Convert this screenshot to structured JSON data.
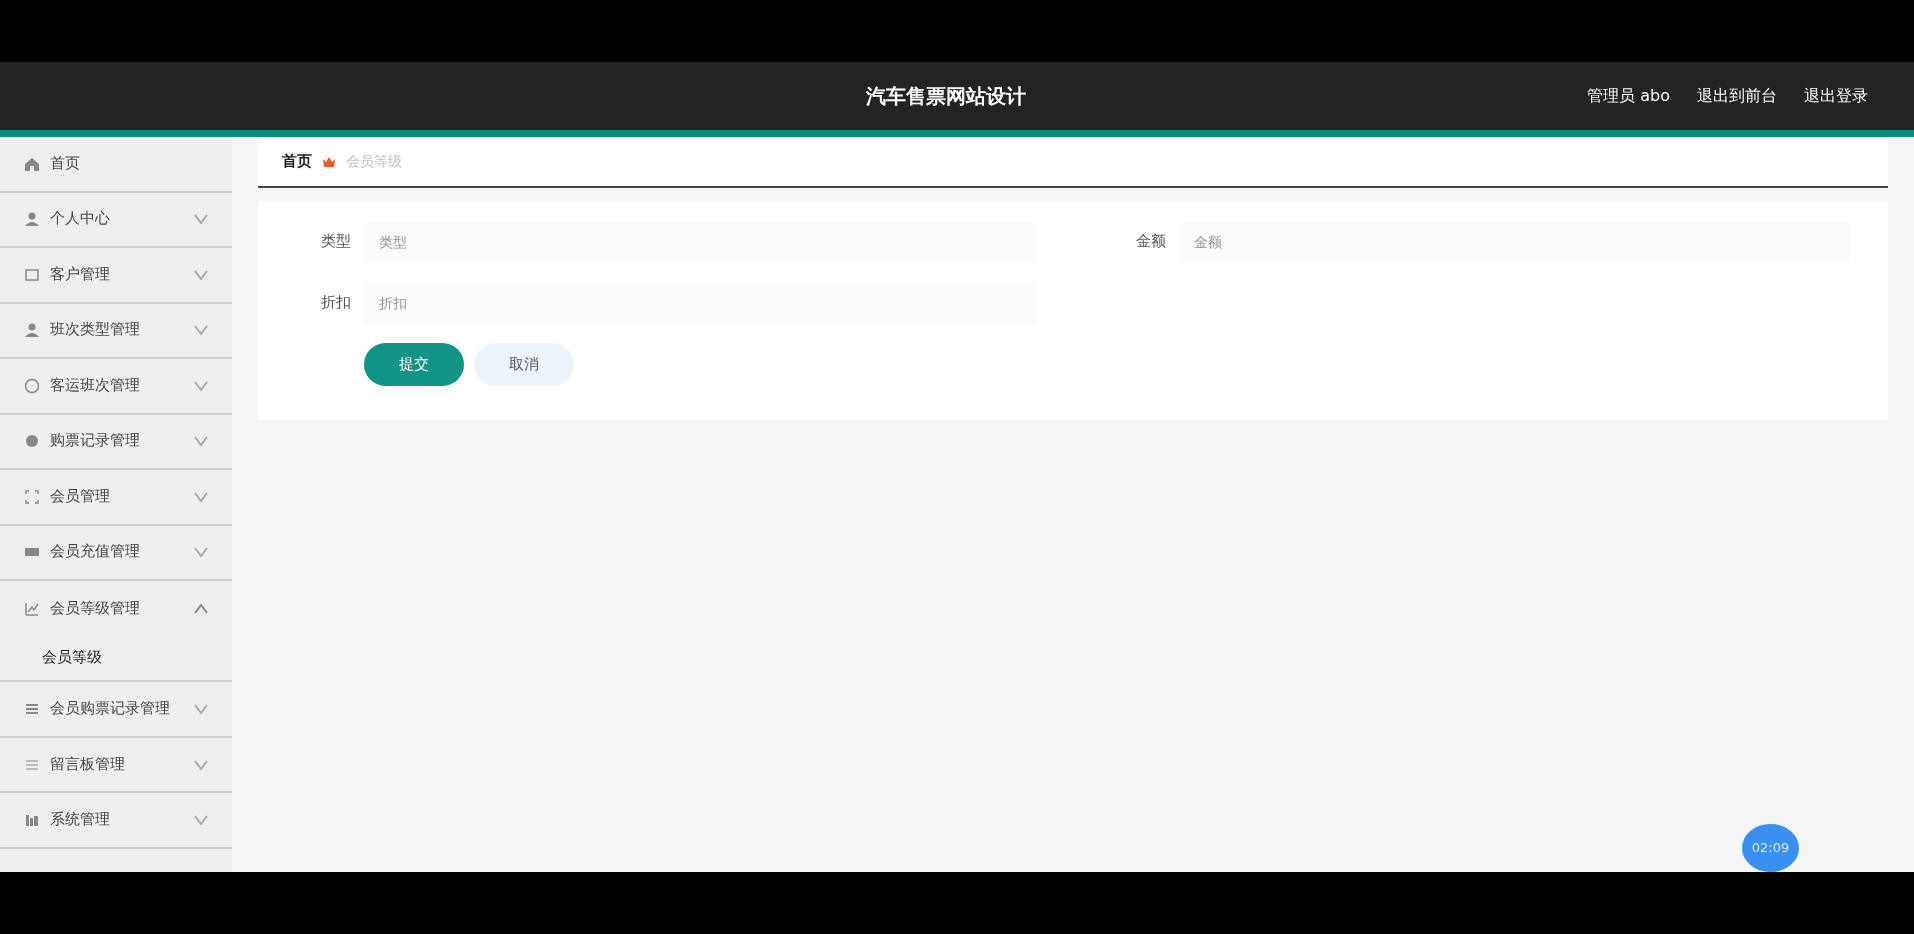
{
  "header": {
    "title": "汽车售票网站设计",
    "links": [
      "管理员 abo",
      "退出到前台",
      "退出登录"
    ]
  },
  "sidebar": {
    "items": [
      {
        "label": "首页",
        "kind": "link"
      },
      {
        "label": "个人中心",
        "kind": "menu",
        "expanded": false
      },
      {
        "label": "客户管理",
        "kind": "menu",
        "expanded": false
      },
      {
        "label": "班次类型管理",
        "kind": "menu",
        "expanded": false
      },
      {
        "label": "客运班次管理",
        "kind": "menu",
        "expanded": false
      },
      {
        "label": "购票记录管理",
        "kind": "menu",
        "expanded": false
      },
      {
        "label": "会员管理",
        "kind": "menu",
        "expanded": false
      },
      {
        "label": "会员充值管理",
        "kind": "menu",
        "expanded": false
      },
      {
        "label": "会员等级管理",
        "kind": "menu",
        "expanded": true,
        "children": [
          {
            "label": "会员等级"
          }
        ]
      },
      {
        "label": "会员购票记录管理",
        "kind": "menu",
        "expanded": false
      },
      {
        "label": "留言板管理",
        "kind": "menu",
        "expanded": false
      },
      {
        "label": "系统管理",
        "kind": "menu",
        "expanded": false
      }
    ]
  },
  "breadcrumb": [
    "首页",
    "会员等级"
  ],
  "form": {
    "fields": [
      {
        "label": "类型",
        "placeholder": "类型"
      },
      {
        "label": "金额",
        "placeholder": "金额"
      },
      {
        "label": "折扣",
        "placeholder": "折扣"
      }
    ],
    "buttons": [
      {
        "label": "提交",
        "kind": "primary"
      },
      {
        "label": "取消",
        "kind": "secondary"
      }
    ]
  },
  "clock_badge": "02:09"
}
